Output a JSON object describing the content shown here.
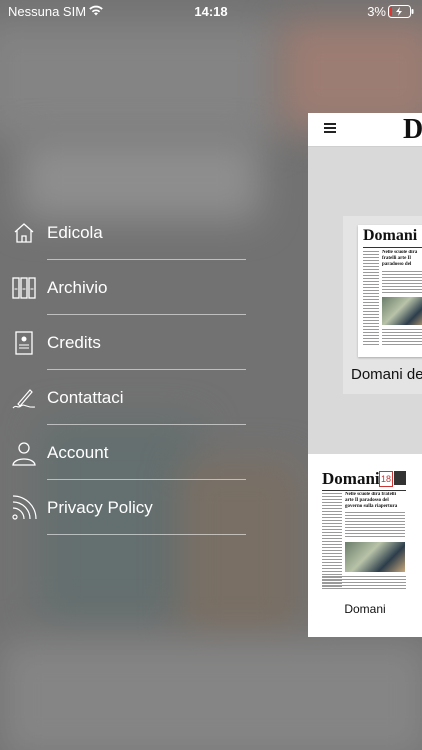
{
  "status_bar": {
    "carrier": "Nessuna SIM",
    "time": "14:18",
    "battery_percent": "3%"
  },
  "menu": {
    "items": [
      {
        "label": "Edicola",
        "icon": "home-icon"
      },
      {
        "label": "Archivio",
        "icon": "archive-binders-icon"
      },
      {
        "label": "Credits",
        "icon": "id-card-icon"
      },
      {
        "label": "Contattaci",
        "icon": "signature-pen-icon"
      },
      {
        "label": "Account",
        "icon": "user-icon"
      },
      {
        "label": "Privacy Policy",
        "icon": "rss-feed-icon"
      }
    ]
  },
  "panel": {
    "brand_initial": "D",
    "featured_caption": "Domani de",
    "featured_cover_masthead": "Domani",
    "issue_card_caption": "Domani",
    "issue_card_masthead": "Domani",
    "issue_card_date_number": "18",
    "headline": "Nelle scuole dirà fratelli arte Il paradosso del governo sulla riapertura sicura"
  },
  "colors": {
    "menu_text": "#ffffff",
    "panel_bg": "#d9d9d9",
    "backdrop": "#6f6f6f"
  }
}
